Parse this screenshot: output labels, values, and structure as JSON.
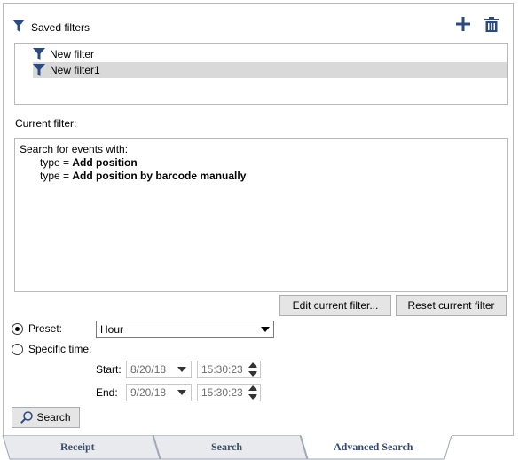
{
  "saved_filters": {
    "title": "Saved filters",
    "add_icon": "plus-icon",
    "delete_icon": "trash-icon",
    "items": [
      {
        "label": "New filter",
        "selected": false
      },
      {
        "label": "New filter1",
        "selected": true
      }
    ]
  },
  "current_filter": {
    "label": "Current filter:",
    "intro": "Search for events with:",
    "conditions": [
      {
        "field": "type =",
        "value": "Add position"
      },
      {
        "field": "type =",
        "value": "Add position by barcode manually"
      }
    ]
  },
  "buttons": {
    "edit": "Edit current filter...",
    "reset": "Reset current filter",
    "search": "Search"
  },
  "time": {
    "preset_label": "Preset:",
    "preset_value": "Hour",
    "specific_label": "Specific time:",
    "start_label": "Start:",
    "end_label": "End:",
    "start_date": "8/20/18",
    "start_time": "15:30:23",
    "end_date": "9/20/18",
    "end_time": "15:30:23",
    "selected_mode": "preset"
  },
  "tabs": [
    {
      "label": "Receipt",
      "active": false
    },
    {
      "label": "Search",
      "active": false
    },
    {
      "label": "Advanced Search",
      "active": true
    }
  ],
  "colors": {
    "accent": "#2a4a80",
    "selection": "#d9d9d9",
    "border": "#b9b9b9",
    "tab_bg": "#e8eaed"
  }
}
